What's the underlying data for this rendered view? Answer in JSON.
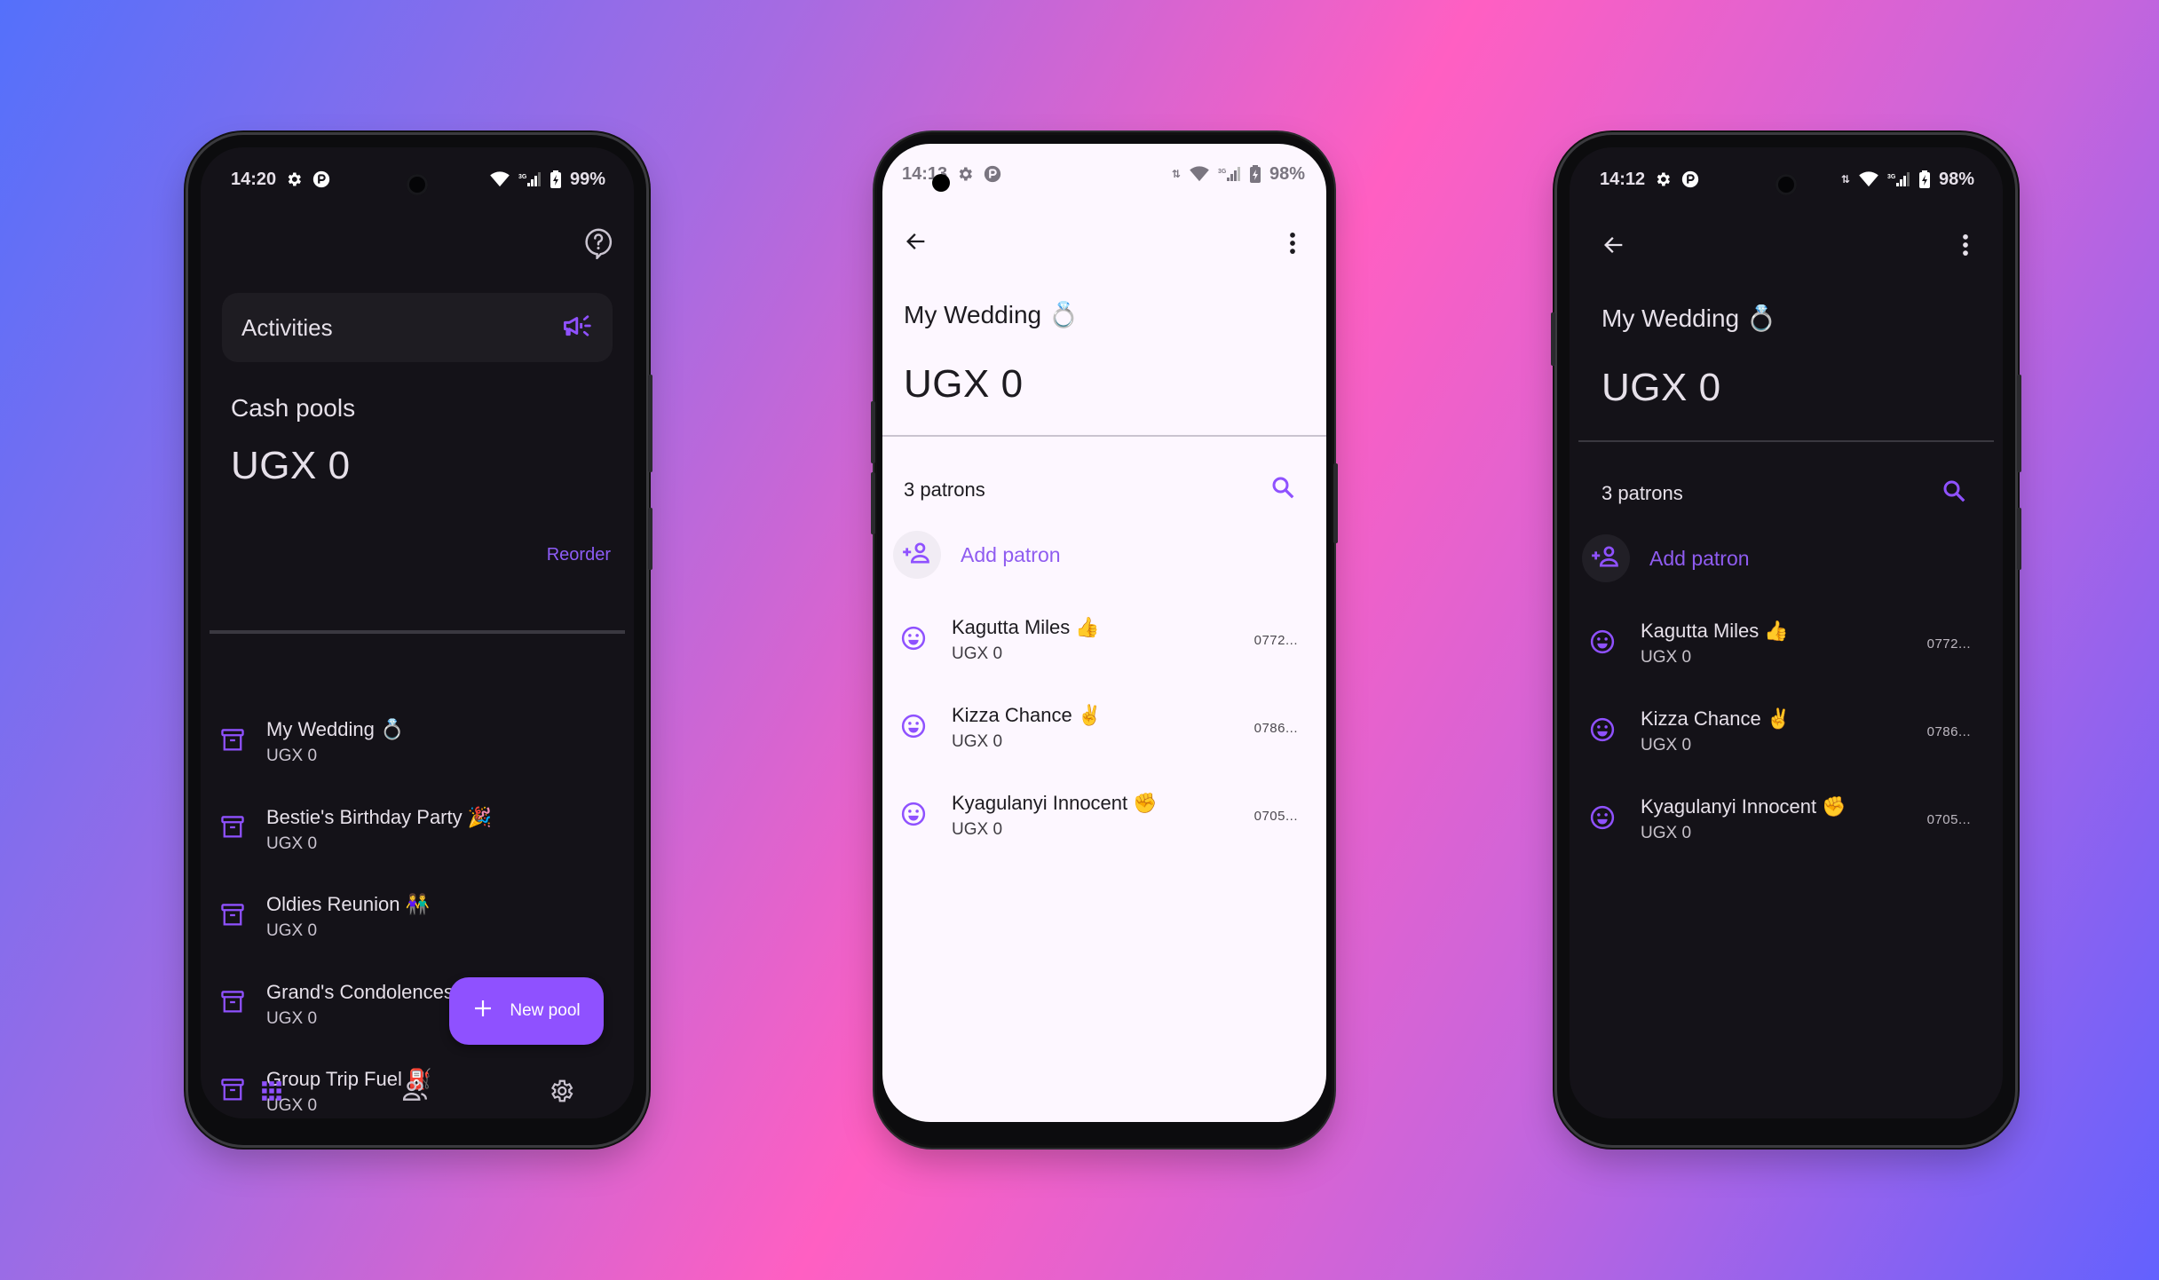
{
  "colors": {
    "accent": "#8f51ff",
    "dark_bg": "#141218",
    "light_bg": "#fdf7ff",
    "card_bg": "#1e1c22"
  },
  "phone_home": {
    "status": {
      "time": "14:20",
      "battery": "99%",
      "network": "3G"
    },
    "help_icon": "help-bubble-icon",
    "activities_card": {
      "label": "Activities",
      "icon": "megaphone-icon"
    },
    "section_title": "Cash pools",
    "total": "UGX 0",
    "reorder_label": "Reorder",
    "pools": [
      {
        "name": "My Wedding 💍",
        "amount": "UGX 0",
        "icon": "archive-box-icon"
      },
      {
        "name": "Bestie's Birthday Party 🎉",
        "amount": "UGX 0",
        "icon": "archive-box-icon"
      },
      {
        "name": "Oldies Reunion 👫",
        "amount": "UGX 0",
        "icon": "archive-box-icon"
      },
      {
        "name": "Grand's Condolences ⚰️",
        "amount": "UGX 0",
        "icon": "archive-box-icon"
      },
      {
        "name": "Group Trip Fuel ⛽",
        "amount": "UGX 0",
        "icon": "archive-box-icon"
      }
    ],
    "fab_label": "New pool",
    "bottom_nav": [
      {
        "name": "pools",
        "icon": "grid-icon",
        "active": true
      },
      {
        "name": "contacts",
        "icon": "people-icon",
        "active": false
      },
      {
        "name": "settings",
        "icon": "gear-icon",
        "active": false
      }
    ]
  },
  "phone_detail_light": {
    "status": {
      "time": "14:13",
      "battery": "98%",
      "network": "3G"
    },
    "title": "My Wedding 💍",
    "total": "UGX 0",
    "patrons_count": "3 patrons",
    "add_patron_label": "Add patron",
    "patrons": [
      {
        "name": "Kagutta Miles 👍",
        "amount": "UGX 0",
        "phone": "0772..."
      },
      {
        "name": "Kizza Chance ✌️",
        "amount": "UGX 0",
        "phone": "0786..."
      },
      {
        "name": "Kyagulanyi Innocent ✊",
        "amount": "UGX 0",
        "phone": "0705..."
      }
    ]
  },
  "phone_detail_dark": {
    "status": {
      "time": "14:12",
      "battery": "98%",
      "network": "3G"
    },
    "title": "My Wedding 💍",
    "total": "UGX 0",
    "patrons_count": "3 patrons",
    "add_patron_label": "Add patron",
    "patrons": [
      {
        "name": "Kagutta Miles 👍",
        "amount": "UGX 0",
        "phone": "0772..."
      },
      {
        "name": "Kizza Chance ✌️",
        "amount": "UGX 0",
        "phone": "0786..."
      },
      {
        "name": "Kyagulanyi Innocent ✊",
        "amount": "UGX 0",
        "phone": "0705..."
      }
    ]
  }
}
